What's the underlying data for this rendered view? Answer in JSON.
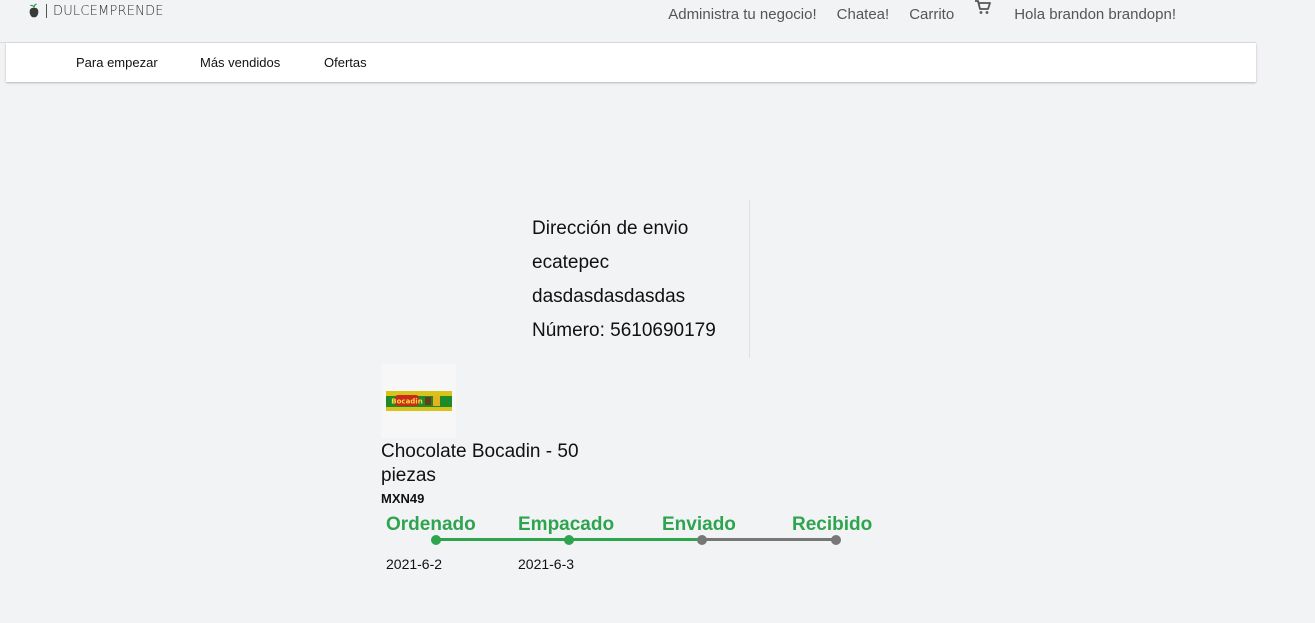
{
  "header": {
    "brand_name": "DULCEMPRENDE",
    "links": {
      "manage": "Administra tu negocio!",
      "chat": "Chatea!",
      "cart": "Carrito",
      "greeting": "Hola brandon brandopn!"
    },
    "cart_icon": "cart-icon"
  },
  "categories": [
    "Para empezar",
    "Más vendidos",
    "Ofertas"
  ],
  "shipping": {
    "title": "Dirección de envio",
    "city": "ecatepec",
    "street": "dasdasdasdasdas",
    "phone": "Número: 5610690179"
  },
  "product": {
    "name": "Chocolate Bocadin - 50 piezas",
    "price": "MXN49",
    "image_text": "Bocadin"
  },
  "tracking": {
    "steps": [
      {
        "label": "Ordenado",
        "date": "2021-6-2",
        "completed": true
      },
      {
        "label": "Empacado",
        "date": "2021-6-3",
        "completed": true
      },
      {
        "label": "Enviado",
        "date": "",
        "completed": false
      },
      {
        "label": "Recibido",
        "date": "",
        "completed": false
      }
    ],
    "completed_color": "#2ea44f",
    "pending_color": "#777777"
  },
  "colors": {
    "accent": "#2ea44f",
    "background": "#f2f3f5"
  }
}
